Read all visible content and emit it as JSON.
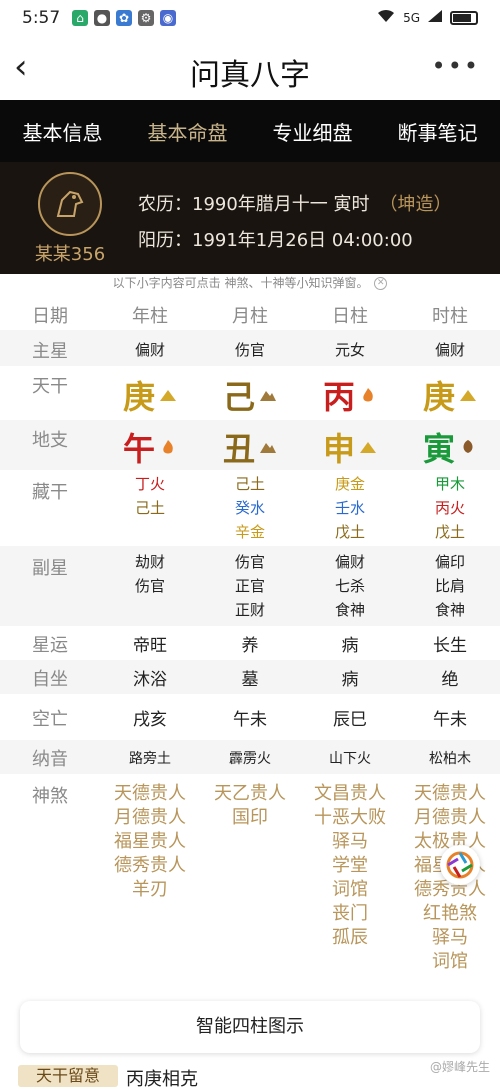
{
  "status": {
    "time": "5:57",
    "signal": "5G"
  },
  "header": {
    "title": "问真八字"
  },
  "tabs": [
    {
      "label": "基本信息"
    },
    {
      "label": "基本命盘"
    },
    {
      "label": "专业细盘"
    },
    {
      "label": "断事笔记"
    }
  ],
  "profile": {
    "name": "某某356",
    "lunar": "农历：1990年腊月十一 寅时",
    "gender": "（坤造）",
    "solar": "阳历：1991年1月26日 04:00:00"
  },
  "notice": "以下小字内容可点击 神煞、十神等小知识弹窗。",
  "table": {
    "header": {
      "label": "日期",
      "cols": [
        "年柱",
        "月柱",
        "日柱",
        "时柱"
      ]
    },
    "zhuxing": {
      "label": "主星",
      "values": [
        "偏财",
        "伤官",
        "元女",
        "偏财"
      ]
    },
    "tiangan": {
      "label": "天干",
      "values": [
        "庚",
        "己",
        "丙",
        "庚"
      ],
      "colors": [
        "#c89a1a",
        "#8a6a1a",
        "#c81e1e",
        "#c89a1a"
      ],
      "icons": [
        "metal-icon",
        "earth-icon",
        "fire-icon",
        "metal-icon"
      ]
    },
    "dizhi": {
      "label": "地支",
      "values": [
        "午",
        "丑",
        "申",
        "寅"
      ],
      "colors": [
        "#c81e1e",
        "#8a6a1a",
        "#c89a1a",
        "#1a9a3a"
      ],
      "icons": [
        "fire-icon",
        "earth-icon",
        "metal-icon",
        "wood-icon"
      ]
    },
    "canggan": {
      "label": "藏干",
      "cols": [
        [
          "丁火",
          "己土"
        ],
        [
          "己土",
          "癸水",
          "辛金"
        ],
        [
          "庚金",
          "壬水",
          "戊土"
        ],
        [
          "甲木",
          "丙火",
          "戊土"
        ]
      ]
    },
    "fuxing": {
      "label": "副星",
      "cols": [
        [
          "劫财",
          "伤官"
        ],
        [
          "伤官",
          "正官",
          "正财"
        ],
        [
          "偏财",
          "七杀",
          "食神"
        ],
        [
          "偏印",
          "比肩",
          "食神"
        ]
      ]
    },
    "xingyun": {
      "label": "星运",
      "values": [
        "帝旺",
        "养",
        "病",
        "长生"
      ]
    },
    "zizuo": {
      "label": "自坐",
      "values": [
        "沐浴",
        "墓",
        "病",
        "绝"
      ]
    },
    "kongwang": {
      "label": "空亡",
      "values": [
        "戌亥",
        "午未",
        "辰巳",
        "午未"
      ]
    },
    "nayin": {
      "label": "纳音",
      "values": [
        "路旁土",
        "霹雳火",
        "山下火",
        "松柏木"
      ]
    },
    "shensha": {
      "label": "神煞",
      "cols": [
        [
          "天德贵人",
          "月德贵人",
          "福星贵人",
          "德秀贵人",
          "羊刃"
        ],
        [
          "天乙贵人",
          "国印"
        ],
        [
          "文昌贵人",
          "十恶大败",
          "驿马",
          "学堂",
          "词馆",
          "丧门",
          "孤辰"
        ],
        [
          "天德贵人",
          "月德贵人",
          "太极贵人",
          "福星贵人",
          "德秀贵人",
          "红艳煞",
          "驿马",
          "词馆"
        ]
      ]
    }
  },
  "smart_button": "智能四柱图示",
  "bottom": {
    "tag": "天干留意",
    "text": "丙庚相克"
  },
  "watermark": "@嫪峰先生"
}
